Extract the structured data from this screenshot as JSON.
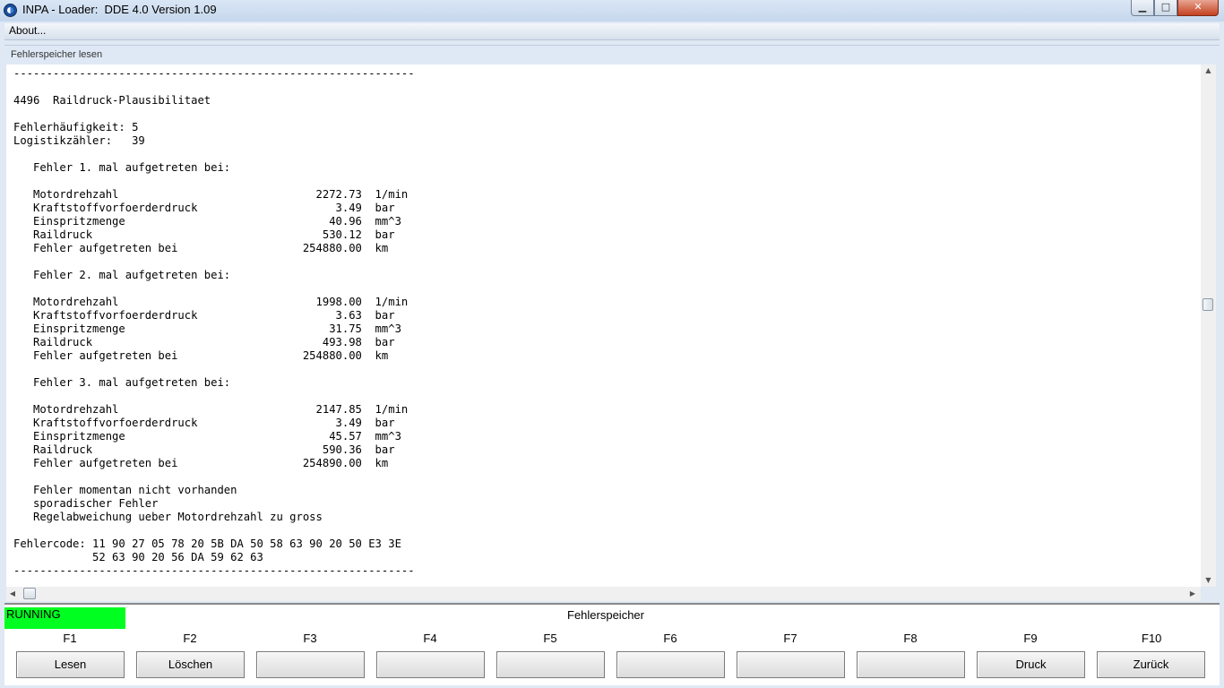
{
  "window": {
    "title": "INPA - Loader:  DDE 4.0 Version 1.09",
    "min_glyph": "▁",
    "max_glyph": "□",
    "close_glyph": "✕"
  },
  "menu": {
    "about": "About..."
  },
  "panel": {
    "title": "Fehlerspeicher lesen"
  },
  "log_lines": [
    "-------------------------------------------------------------",
    "",
    "4496  Raildruck-Plausibilitaet",
    "",
    "Fehlerhäufigkeit: 5",
    "Logistikzähler:   39",
    "",
    "   Fehler 1. mal aufgetreten bei:",
    "",
    "   Motordrehzahl                              2272.73  1/min",
    "   Kraftstoffvorfoerderdruck                     3.49  bar",
    "   Einspritzmenge                               40.96  mm^3",
    "   Raildruck                                   530.12  bar",
    "   Fehler aufgetreten bei                   254880.00  km",
    "",
    "   Fehler 2. mal aufgetreten bei:",
    "",
    "   Motordrehzahl                              1998.00  1/min",
    "   Kraftstoffvorfoerderdruck                     3.63  bar",
    "   Einspritzmenge                               31.75  mm^3",
    "   Raildruck                                   493.98  bar",
    "   Fehler aufgetreten bei                   254880.00  km",
    "",
    "   Fehler 3. mal aufgetreten bei:",
    "",
    "   Motordrehzahl                              2147.85  1/min",
    "   Kraftstoffvorfoerderdruck                     3.49  bar",
    "   Einspritzmenge                               45.57  mm^3",
    "   Raildruck                                   590.36  bar",
    "   Fehler aufgetreten bei                   254890.00  km",
    "",
    "   Fehler momentan nicht vorhanden",
    "   sporadischer Fehler",
    "   Regelabweichung ueber Motordrehzahl zu gross",
    "",
    "Fehlercode: 11 90 27 05 78 20 5B DA 50 58 63 90 20 50 E3 3E",
    "            52 63 90 20 56 DA 59 62 63",
    "-------------------------------------------------------------"
  ],
  "scroll": {
    "up": "▲",
    "down": "▼",
    "left": "◀",
    "right": "▶"
  },
  "status": {
    "text": "RUNNING",
    "color": "#00ff21"
  },
  "section_title": "Fehlerspeicher",
  "fkeys": [
    {
      "key": "F1",
      "label": "Lesen"
    },
    {
      "key": "F2",
      "label": "Löschen"
    },
    {
      "key": "F3",
      "label": ""
    },
    {
      "key": "F4",
      "label": ""
    },
    {
      "key": "F5",
      "label": ""
    },
    {
      "key": "F6",
      "label": ""
    },
    {
      "key": "F7",
      "label": ""
    },
    {
      "key": "F8",
      "label": ""
    },
    {
      "key": "F9",
      "label": "Druck"
    },
    {
      "key": "F10",
      "label": "Zurück"
    }
  ]
}
